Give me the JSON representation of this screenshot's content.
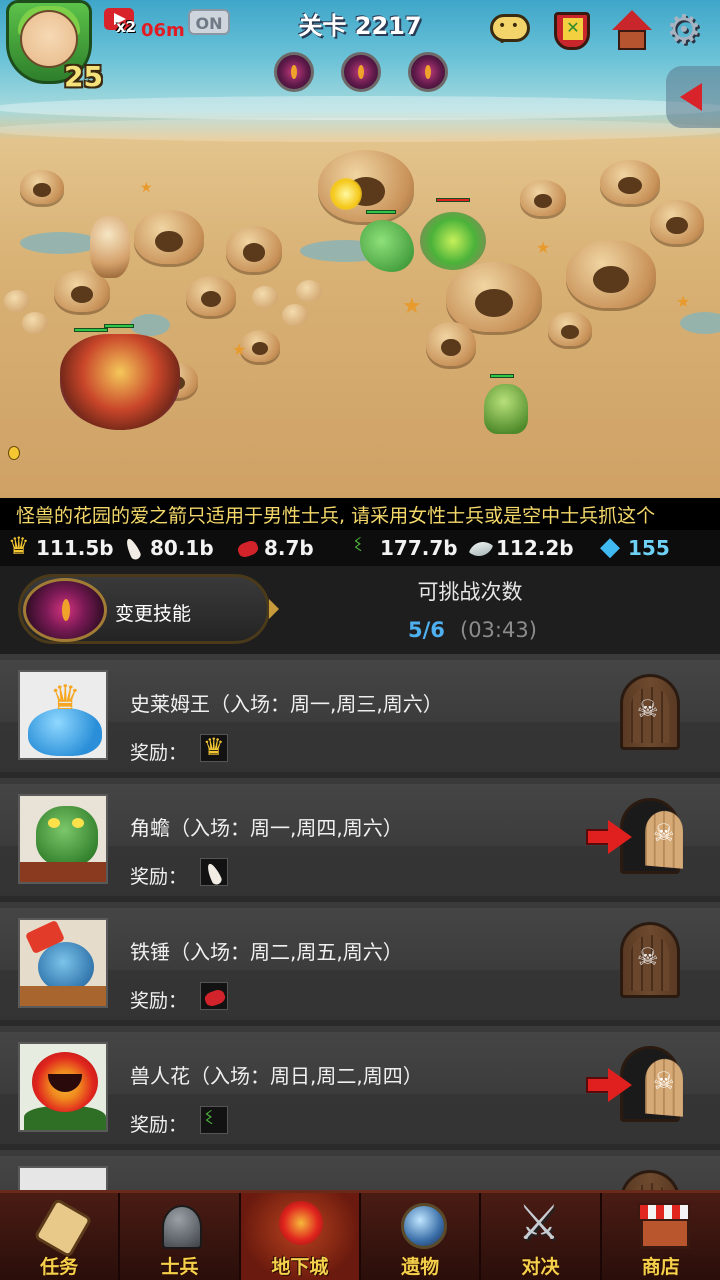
{
  "hud": {
    "level": "25",
    "speed_multiplier": "x2",
    "speed_time": "06m",
    "speed_toggle": "ON",
    "stage_title": "关卡 2217",
    "icons": [
      "chat-icon",
      "guild-icon",
      "house-icon",
      "gear-icon"
    ],
    "boss_orbs": 3
  },
  "ticker": {
    "text": "怪兽的花园的爱之箭只适用于男性士兵, 请采用女性士兵或是空中士兵抓这个"
  },
  "resources": [
    {
      "icon": "crown-icon",
      "value": "111.5b"
    },
    {
      "icon": "fang-icon",
      "value": "80.1b"
    },
    {
      "icon": "blood-icon",
      "value": "8.7b"
    },
    {
      "icon": "vine-icon",
      "value": "177.7b"
    },
    {
      "icon": "horn-icon",
      "value": "112.2b"
    },
    {
      "icon": "gem-icon",
      "value": "155"
    }
  ],
  "skill": {
    "change_label": "变更技能"
  },
  "challenges": {
    "title": "可挑战次数",
    "count": "5/6",
    "timer": "(03:43)"
  },
  "dungeons": [
    {
      "name": "史莱姆王（入场：周一,周三,周六）",
      "reward_label": "奖励：",
      "reward_icon": "crown-icon",
      "available": false
    },
    {
      "name": "角蟾（入场：周一,周四,周六）",
      "reward_label": "奖励：",
      "reward_icon": "fang-icon",
      "available": true
    },
    {
      "name": "铁锤（入场：周二,周五,周六）",
      "reward_label": "奖励：",
      "reward_icon": "blood-icon",
      "available": false
    },
    {
      "name": "兽人花（入场：周日,周二,周四）",
      "reward_label": "奖励：",
      "reward_icon": "vine-icon",
      "available": true
    }
  ],
  "nav": [
    {
      "label": "任务",
      "icon": "scroll-icon",
      "active": false
    },
    {
      "label": "士兵",
      "icon": "helmet-icon",
      "active": false
    },
    {
      "label": "地下城",
      "icon": "flower-icon",
      "active": true
    },
    {
      "label": "遗物",
      "icon": "orb-icon",
      "active": false
    },
    {
      "label": "对决",
      "icon": "swords-icon",
      "active": false
    },
    {
      "label": "商店",
      "icon": "shop-icon",
      "active": false
    }
  ]
}
